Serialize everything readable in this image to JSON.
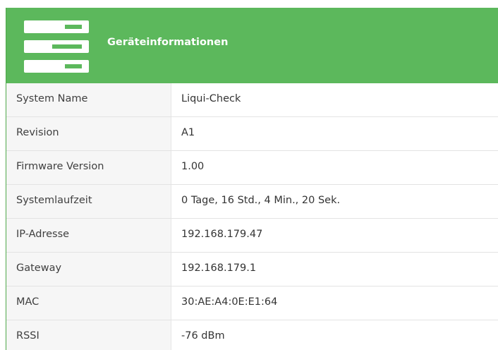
{
  "header": {
    "title": "Geräteinformationen",
    "icon": "server-icon",
    "color": "#5cb85c"
  },
  "rows": [
    {
      "label": "System Name",
      "value": "Liqui-Check"
    },
    {
      "label": "Revision",
      "value": "A1"
    },
    {
      "label": "Firmware Version",
      "value": "1.00"
    },
    {
      "label": "Systemlaufzeit",
      "value": "0 Tage, 16 Std., 4 Min., 20 Sek."
    },
    {
      "label": "IP-Adresse",
      "value": "192.168.179.47"
    },
    {
      "label": "Gateway",
      "value": "192.168.179.1"
    },
    {
      "label": "MAC",
      "value": "30:AE:A4:0E:E1:64"
    },
    {
      "label": "RSSI",
      "value": "-76 dBm"
    }
  ]
}
